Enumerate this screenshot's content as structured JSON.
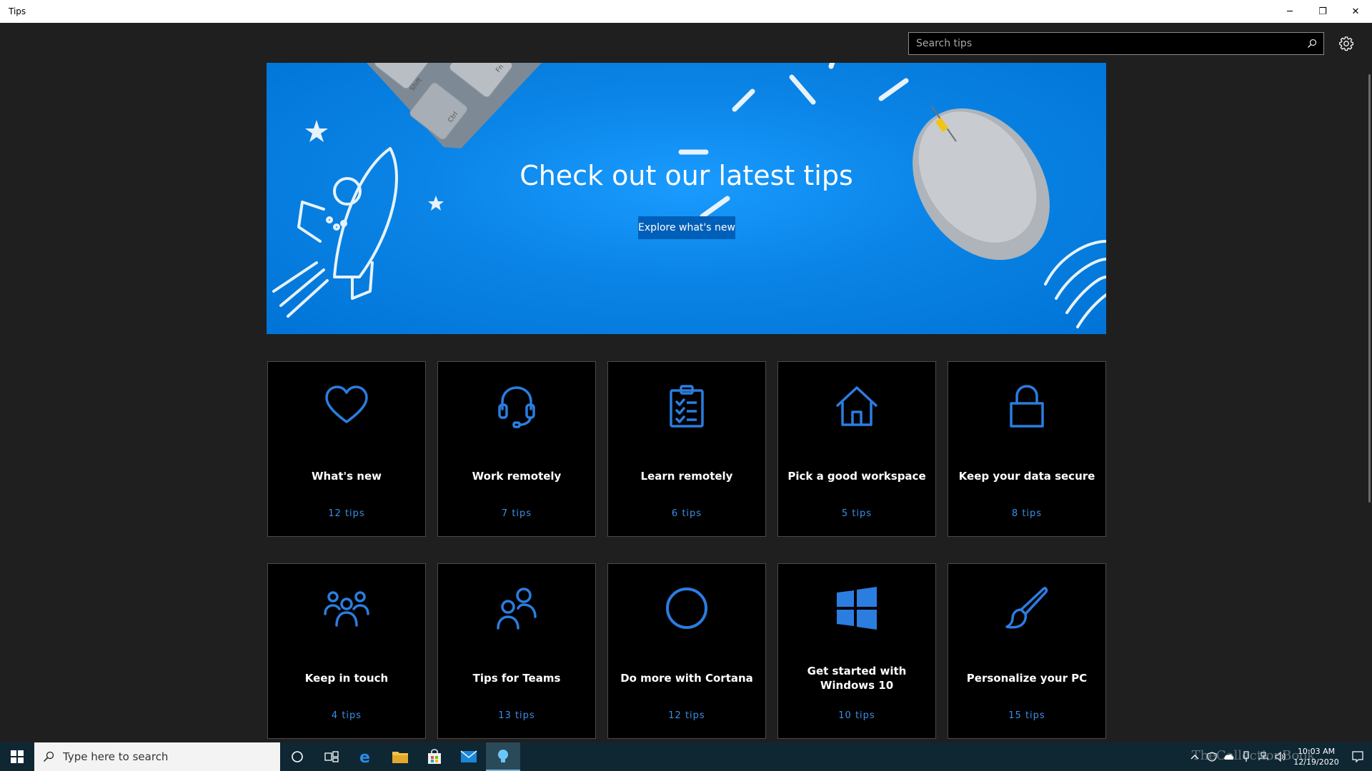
{
  "window": {
    "title": "Tips",
    "minimize": "─",
    "maximize": "❐",
    "close": "✕"
  },
  "header": {
    "search_placeholder": "Search tips"
  },
  "hero": {
    "headline": "Check out our latest tips",
    "cta": "Explore what's new",
    "key_labels": [
      "Shift",
      "Ctrl",
      "Fn"
    ]
  },
  "cards": [
    {
      "title": "What's new",
      "count": "12 tips",
      "icon": "heart-icon"
    },
    {
      "title": "Work remotely",
      "count": "7 tips",
      "icon": "headset-icon"
    },
    {
      "title": "Learn remotely",
      "count": "6 tips",
      "icon": "clipboard-checklist-icon"
    },
    {
      "title": "Pick a good workspace",
      "count": "5 tips",
      "icon": "home-icon"
    },
    {
      "title": "Keep your data secure",
      "count": "8 tips",
      "icon": "lock-icon"
    },
    {
      "title": "Keep in touch",
      "count": "4 tips",
      "icon": "people-group-icon"
    },
    {
      "title": "Tips for Teams",
      "count": "13 tips",
      "icon": "people-pair-icon"
    },
    {
      "title": "Do more with Cortana",
      "count": "12 tips",
      "icon": "cortana-circle-icon"
    },
    {
      "title": "Get started with Windows 10",
      "count": "10 tips",
      "icon": "windows-logo-icon"
    },
    {
      "title": "Personalize your PC",
      "count": "15 tips",
      "icon": "paintbrush-icon"
    }
  ],
  "taskbar": {
    "search_placeholder": "Type here to search",
    "time": "10:03 AM",
    "date": "12/19/2020",
    "watermark": "TheCollectionBook"
  },
  "colors": {
    "accent": "#3a8fe8",
    "hero": "#0a84e6",
    "taskbar": "#0f2733"
  }
}
